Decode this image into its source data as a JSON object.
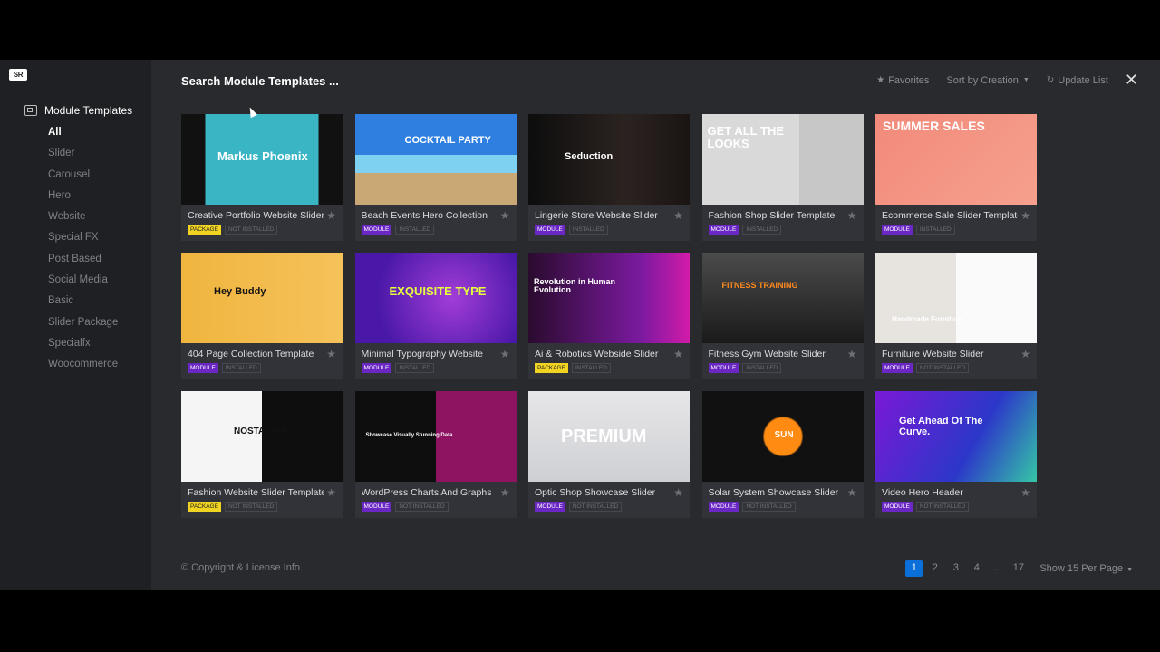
{
  "logo": "SR",
  "sidebar": {
    "heading": "Module Templates",
    "categories": [
      "All",
      "Slider",
      "Carousel",
      "Hero",
      "Website",
      "Special FX",
      "Post Based",
      "Social Media",
      "Basic",
      "Slider Package",
      "Specialfx",
      "Woocommerce"
    ]
  },
  "header": {
    "search": "Search Module Templates ...",
    "favorites": "Favorites",
    "sort": "Sort by Creation",
    "update": "Update List"
  },
  "cards": [
    {
      "title": "Creative Portfolio Website Slider",
      "type": "PACKAGE",
      "status": "NOT INSTALLED",
      "thumb_text": "Markus Phoenix"
    },
    {
      "title": "Beach Events Hero Collection",
      "type": "MODULE",
      "status": "INSTALLED",
      "thumb_text": "COCKTAIL PARTY"
    },
    {
      "title": "Lingerie Store Website Slider",
      "type": "MODULE",
      "status": "INSTALLED",
      "thumb_text": "Seduction"
    },
    {
      "title": "Fashion Shop Slider Template",
      "type": "MODULE",
      "status": "INSTALLED",
      "thumb_text": "GET ALL THE LOOKS"
    },
    {
      "title": "Ecommerce Sale Slider Template",
      "type": "MODULE",
      "status": "INSTALLED",
      "thumb_text": "SUMMER SALES"
    },
    {
      "title": "404 Page Collection Template",
      "type": "MODULE",
      "status": "INSTALLED",
      "thumb_text": "Hey Buddy"
    },
    {
      "title": "Minimal Typography Website",
      "type": "MODULE",
      "status": "INSTALLED",
      "thumb_text": "EXQUISITE TYPE"
    },
    {
      "title": "Ai & Robotics Webside Slider",
      "type": "PACKAGE",
      "status": "INSTALLED",
      "thumb_text": "Revolution in Human Evolution"
    },
    {
      "title": "Fitness Gym Website Slider",
      "type": "MODULE",
      "status": "INSTALLED",
      "thumb_text": "FITNESS TRAINING"
    },
    {
      "title": "Furniture Website Slider",
      "type": "MODULE",
      "status": "NOT INSTALLED",
      "thumb_text": "Handmade Furniture"
    },
    {
      "title": "Fashion Website Slider Template",
      "type": "PACKAGE",
      "status": "NOT INSTALLED",
      "thumb_text": "NOSTALGIA"
    },
    {
      "title": "WordPress Charts And Graphs",
      "type": "MODULE",
      "status": "NOT INSTALLED",
      "thumb_text": "Showcase Visually Stunning Data"
    },
    {
      "title": "Optic Shop Showcase Slider",
      "type": "MODULE",
      "status": "NOT INSTALLED",
      "thumb_text": "PREMIUM"
    },
    {
      "title": "Solar System Showcase Slider",
      "type": "MODULE",
      "status": "NOT INSTALLED",
      "thumb_text": "SUN"
    },
    {
      "title": "Video Hero Header",
      "type": "MODULE",
      "status": "NOT INSTALLED",
      "thumb_text": "Get Ahead Of The Curve."
    }
  ],
  "footer": {
    "copyright": "© Copyright & License Info",
    "pages": [
      "1",
      "2",
      "3",
      "4",
      "...",
      "17"
    ],
    "current_page": "1",
    "per_page": "Show 15 Per Page"
  },
  "colors": {
    "module_tag": "#6a27c4",
    "package_tag": "#f1d422",
    "active_page": "#0a6fd8"
  },
  "icons": {
    "favorites": "star-icon",
    "update": "refresh-icon",
    "close": "close-icon",
    "sidebar_heading": "image-icon"
  }
}
